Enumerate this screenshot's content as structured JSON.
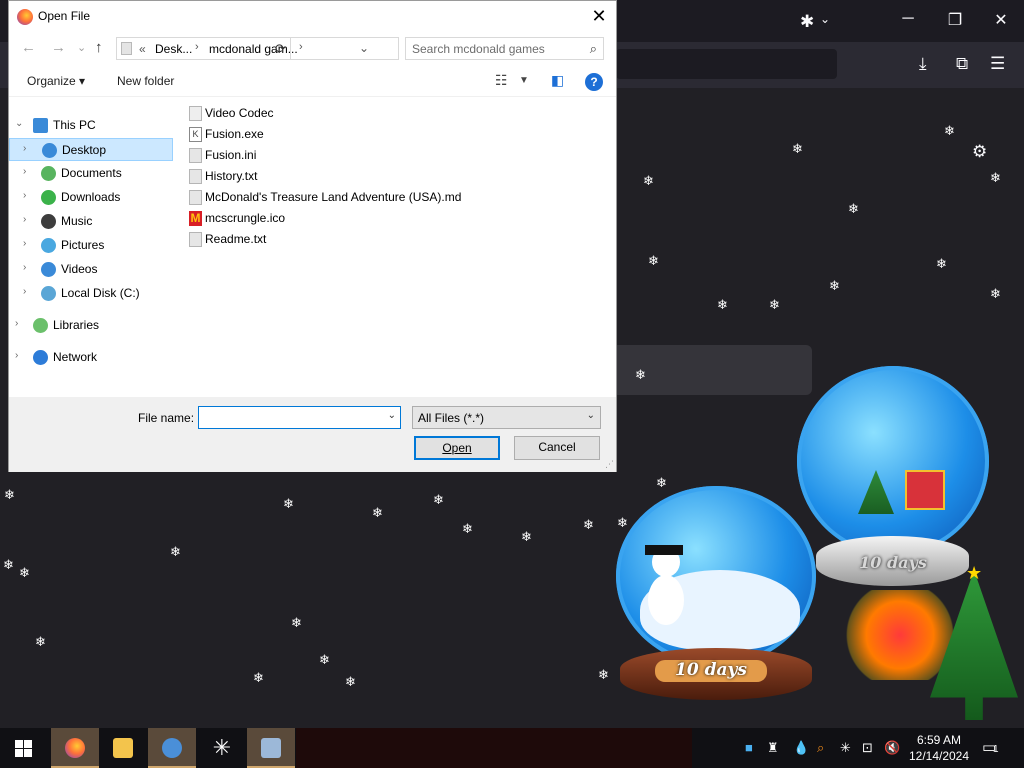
{
  "dialog": {
    "title": "Open File",
    "address": {
      "prefix": "«",
      "crumbs": [
        "Desk...",
        "mcdonald gam..."
      ]
    },
    "search_placeholder": "Search mcdonald games",
    "toolbar": {
      "organize": "Organize ▾",
      "new_folder": "New folder",
      "help": "?"
    },
    "nav": [
      {
        "label": "This PC",
        "icon": "computer-icon",
        "color": "#3a8ad8"
      },
      {
        "label": "Desktop",
        "icon": "desktop-icon",
        "color": "#3a8ad8"
      },
      {
        "label": "Documents",
        "icon": "documents-icon",
        "color": "#58b45f"
      },
      {
        "label": "Downloads",
        "icon": "downloads-icon",
        "color": "#3bb24a"
      },
      {
        "label": "Music",
        "icon": "music-icon",
        "color": "#3d3d3d"
      },
      {
        "label": "Pictures",
        "icon": "pictures-icon",
        "color": "#4aa8e0"
      },
      {
        "label": "Videos",
        "icon": "videos-icon",
        "color": "#3a8ad8"
      },
      {
        "label": "Local Disk (C:)",
        "icon": "disk-icon",
        "color": "#5aa6d6"
      },
      {
        "label": "Libraries",
        "icon": "libraries-icon",
        "color": "#6bc06b"
      },
      {
        "label": "Network",
        "icon": "network-icon",
        "color": "#2d7cd8"
      }
    ],
    "files": [
      {
        "name": "Video Codec",
        "icon": "folder-icon"
      },
      {
        "name": "Fusion.exe",
        "icon": "exe-icon"
      },
      {
        "name": "Fusion.ini",
        "icon": "ini-file-icon"
      },
      {
        "name": "History.txt",
        "icon": "text-file-icon"
      },
      {
        "name": "McDonald's Treasure Land Adventure (USA).md",
        "icon": "md-file-icon"
      },
      {
        "name": "mcscrungle.ico",
        "icon": "mcdonalds-icon"
      },
      {
        "name": "Readme.txt",
        "icon": "text-file-icon"
      }
    ],
    "file_name_label": "File name:",
    "file_name_value": "",
    "filter": "All Files (*.*)",
    "open_button": "Open",
    "cancel_button": "Cancel"
  },
  "wallpaper": {
    "globe1_label": "10 days",
    "globe2_label": "10 days"
  },
  "taskbar": {
    "time": "6:59 AM",
    "date": "12/14/2024",
    "notification_count": "1"
  }
}
